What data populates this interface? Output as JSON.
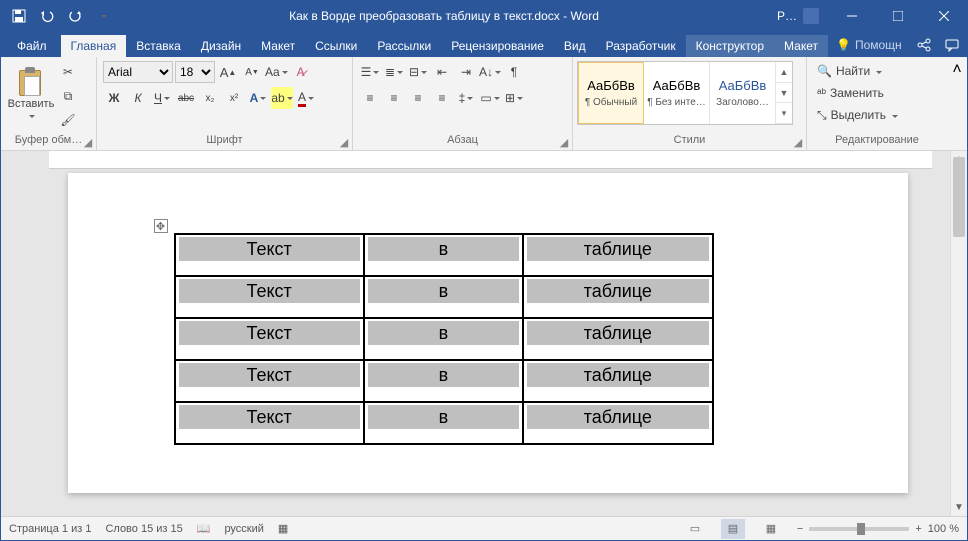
{
  "title": "Как в Ворде преобразовать таблицу в текст.docx - Word",
  "user": "P…",
  "tabs": {
    "file": "Файл",
    "home": "Главная",
    "insert": "Вставка",
    "design": "Дизайн",
    "layout": "Макет",
    "references": "Ссылки",
    "mailings": "Рассылки",
    "review": "Рецензирование",
    "view": "Вид",
    "developer": "Разработчик",
    "table_design": "Конструктор",
    "table_layout": "Макет",
    "tell_me": "Помощн"
  },
  "ribbon": {
    "clipboard": {
      "label": "Буфер обм…",
      "paste": "Вставить"
    },
    "font": {
      "label": "Шрифт",
      "name": "Arial",
      "size": "18",
      "bold": "Ж",
      "italic": "К",
      "underline": "Ч",
      "strike": "abc",
      "sub": "x₂",
      "sup": "x²",
      "grow": "A",
      "shrink": "A",
      "case": "Aa",
      "clear": "?",
      "textfx": "A",
      "highlight": "aʙ",
      "color": "A"
    },
    "paragraph": {
      "label": "Абзац"
    },
    "styles": {
      "label": "Стили",
      "items": [
        {
          "preview": "АаБбВв",
          "name": "¶ Обычный"
        },
        {
          "preview": "АаБбВв",
          "name": "¶ Без инте…"
        },
        {
          "preview": "АаБбВв",
          "name": "Заголово…"
        }
      ]
    },
    "editing": {
      "label": "Редактирование",
      "find": "Найти",
      "replace": "Заменить",
      "select": "Выделить"
    }
  },
  "table": {
    "rows": [
      [
        "Текст",
        "в",
        "таблице"
      ],
      [
        "Текст",
        "в",
        "таблице"
      ],
      [
        "Текст",
        "в",
        "таблице"
      ],
      [
        "Текст",
        "в",
        "таблице"
      ],
      [
        "Текст",
        "в",
        "таблице"
      ]
    ]
  },
  "status": {
    "page": "Страница 1 из 1",
    "words": "Слово 15 из 15",
    "language": "русский",
    "zoom": "100 %"
  }
}
